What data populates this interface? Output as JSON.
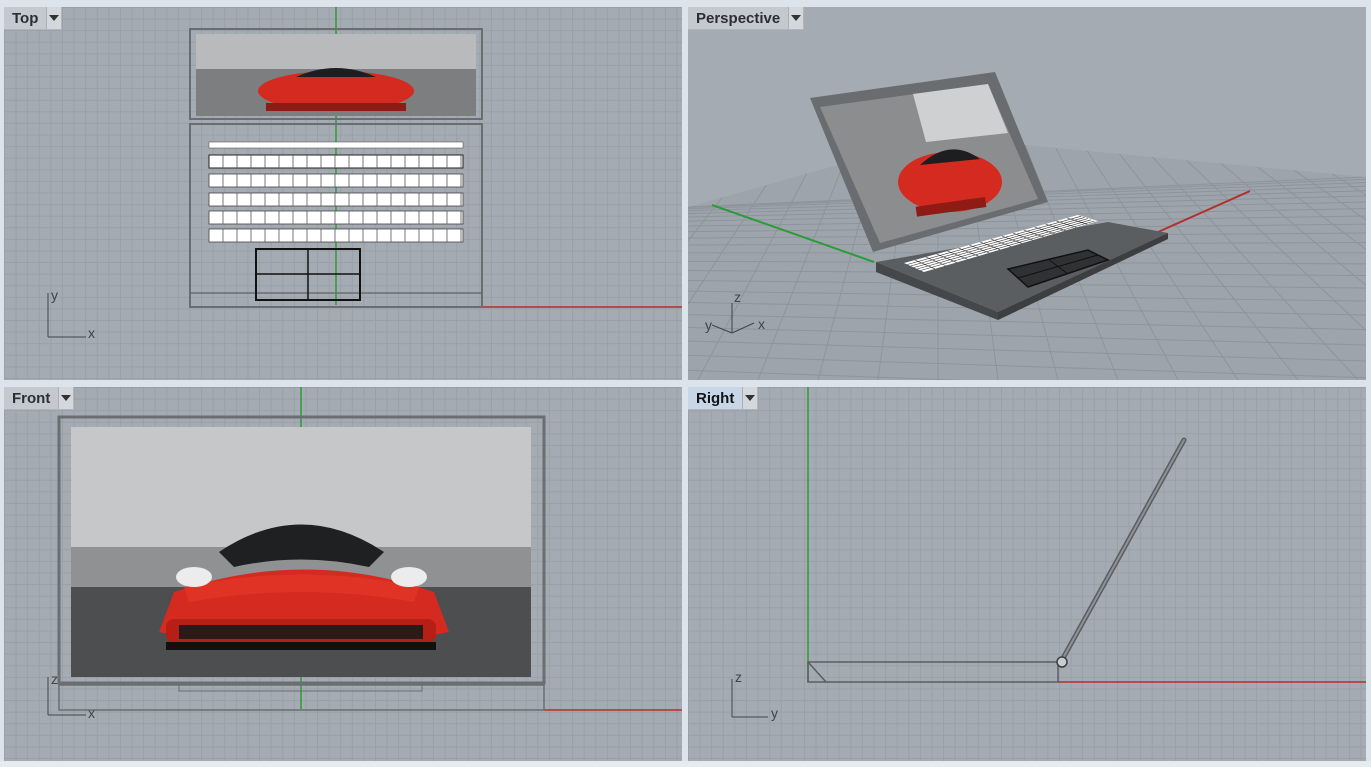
{
  "viewports": {
    "top": {
      "title": "Top",
      "axis_x": "x",
      "axis_y": "y"
    },
    "perspective": {
      "title": "Perspective",
      "axis_x": "x",
      "axis_y": "y",
      "axis_z": "z"
    },
    "front": {
      "title": "Front",
      "axis_x": "x",
      "axis_z": "z"
    },
    "right": {
      "title": "Right",
      "axis_y": "y",
      "axis_z": "z",
      "active": true
    }
  },
  "colors": {
    "x_axis": "#b0302e",
    "y_axis": "#2e9b3a",
    "grid_bg": "#a5abb2",
    "car_red": "#d42a1f"
  },
  "icons": [
    "viewport-menu-icon",
    "axis-widget-icon"
  ]
}
